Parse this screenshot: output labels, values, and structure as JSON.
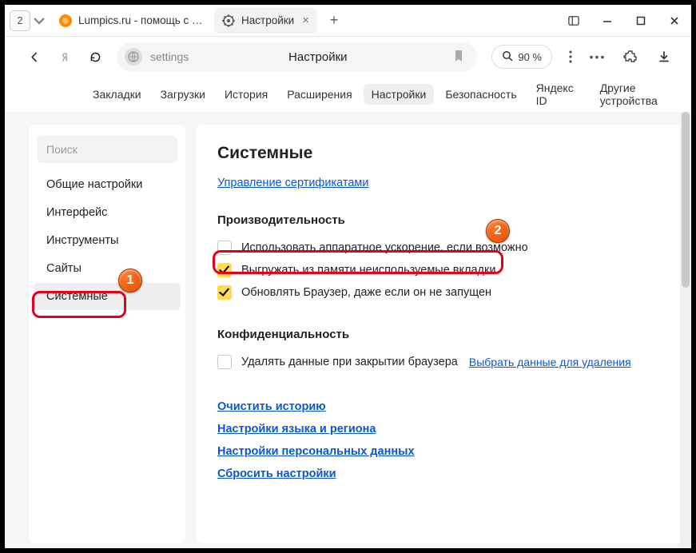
{
  "tabs": {
    "count": "2",
    "first": {
      "label": "Lumpics.ru - помощь с ком"
    },
    "second": {
      "label": "Настройки"
    }
  },
  "toolbar": {
    "url_text": "settings",
    "title": "Настройки",
    "zoom": "90 %"
  },
  "subnav": {
    "items": [
      "Закладки",
      "Загрузки",
      "История",
      "Расширения",
      "Настройки",
      "Безопасность",
      "Яндекс ID",
      "Другие устройства"
    ],
    "active_index": 4
  },
  "sidebar": {
    "search_placeholder": "Поиск",
    "items": [
      "Общие настройки",
      "Интерфейс",
      "Инструменты",
      "Сайты",
      "Системные"
    ],
    "active_index": 4
  },
  "pane": {
    "heading": "Системные",
    "cert_link": "Управление сертификатами",
    "perf_heading": "Производительность",
    "perf_opts": [
      {
        "label": "Использовать аппаратное ускорение, если возможно",
        "checked": false
      },
      {
        "label": "Выгружать из памяти неиспользуемые вкладки",
        "checked": true
      },
      {
        "label": "Обновлять Браузер, даже если он не запущен",
        "checked": true
      }
    ],
    "priv_heading": "Конфиденциальность",
    "priv_opt": {
      "label": "Удалять данные при закрытии браузера",
      "checked": false
    },
    "priv_link": "Выбрать данные для удаления",
    "links": [
      "Очистить историю",
      "Настройки языка и региона",
      "Настройки персональных данных",
      "Сбросить настройки"
    ]
  },
  "badges": {
    "one": "1",
    "two": "2"
  }
}
